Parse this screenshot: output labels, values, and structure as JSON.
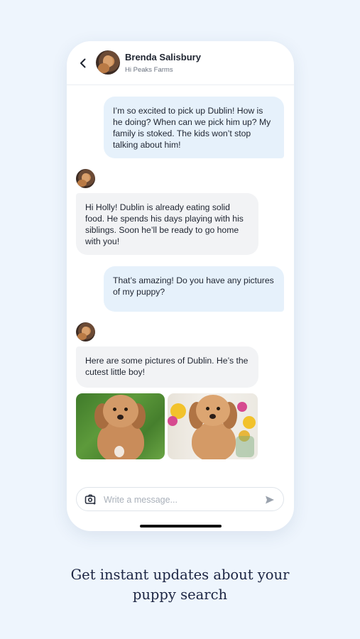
{
  "header": {
    "contact_name": "Brenda Salisbury",
    "contact_subtitle": "Hi Peaks Farms"
  },
  "messages": [
    {
      "direction": "outgoing",
      "text": "I’m so excited to pick up Dublin! How is he doing? When can we pick him up? My family is stoked. The kids won’t stop talking about him!"
    },
    {
      "direction": "incoming",
      "text": "Hi Holly! Dublin is already eating solid food. He spends his days playing with his siblings. Soon he’ll be ready to go home with you!"
    },
    {
      "direction": "outgoing",
      "text": "That’s amazing! Do you have any pictures of my puppy?"
    },
    {
      "direction": "incoming",
      "text": "Here are some pictures of Dublin. He’s the cutest little boy!"
    }
  ],
  "photos": [
    {
      "subject": "puppy on grass"
    },
    {
      "subject": "puppy with flowers"
    }
  ],
  "composer": {
    "placeholder": "Write a message..."
  },
  "caption": {
    "line1": "Get instant updates about your",
    "line2": "puppy search"
  },
  "icons": {
    "back": "chevron-left-icon",
    "camera": "camera-icon",
    "send": "send-icon"
  },
  "colors": {
    "page_background": "#eef5fd",
    "outgoing_bubble": "#e6f1fb",
    "incoming_bubble": "#f2f3f5",
    "caption_text": "#1b2442"
  }
}
